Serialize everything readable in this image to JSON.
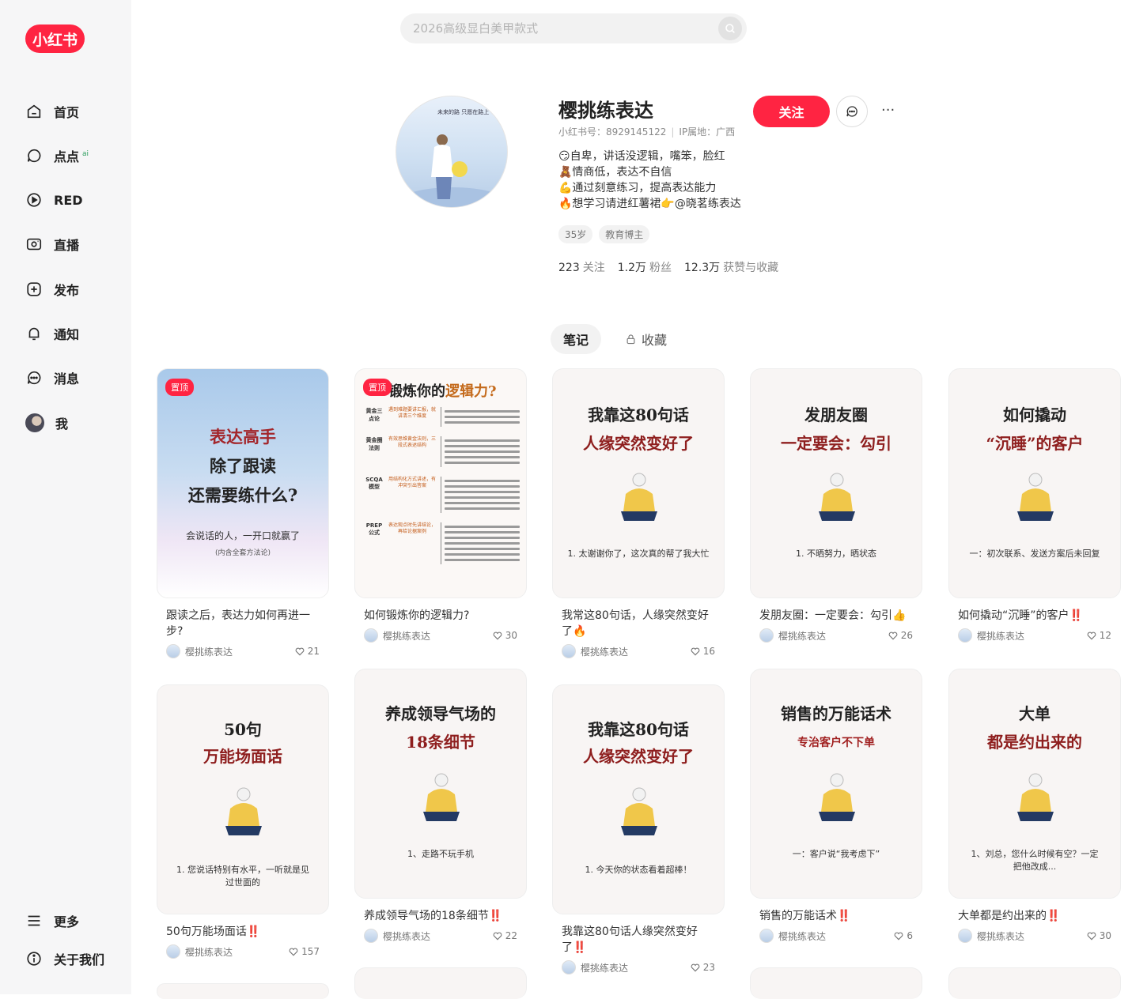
{
  "logo": "小红书",
  "nav": [
    {
      "label": "首页",
      "icon": "home-icon"
    },
    {
      "label": "点点",
      "icon": "chat-bubble-icon",
      "badge": "ai"
    },
    {
      "label": "RED",
      "icon": "play-icon"
    },
    {
      "label": "直播",
      "icon": "live-icon"
    },
    {
      "label": "发布",
      "icon": "plus-square-icon"
    },
    {
      "label": "通知",
      "icon": "bell-icon"
    },
    {
      "label": "消息",
      "icon": "message-icon"
    },
    {
      "label": "我",
      "icon": "avatar"
    }
  ],
  "nav_bottom": [
    {
      "label": "更多",
      "icon": "menu-icon"
    },
    {
      "label": "关于我们",
      "icon": "info-icon"
    }
  ],
  "search": {
    "placeholder": "2026高级显白美甲款式"
  },
  "profile": {
    "avatar_text": "未来的路 只愿在路上",
    "name": "樱挑练表达",
    "id_label": "小红书号：8929145122",
    "ip_label": "IP属地：广西",
    "bio": [
      "😏自卑，讲话没逻辑，嘴笨，脸红",
      "🧸情商低，表达不自信",
      "💪通过刻意练习，提高表达能力",
      "🔥想学习请进红薯裙👉@晓茗练表达"
    ],
    "tags": [
      "35岁",
      "教育博主"
    ],
    "stats": [
      {
        "value": "223",
        "label": "关注"
      },
      {
        "value": "1.2万",
        "label": "粉丝"
      },
      {
        "value": "12.3万",
        "label": "获赞与收藏"
      }
    ],
    "follow_label": "关注",
    "more_label": "···"
  },
  "tabs": [
    {
      "label": "笔记",
      "active": true
    },
    {
      "label": "收藏",
      "active": false,
      "icon": "lock-icon"
    }
  ],
  "pin_label": "置顶",
  "author": "樱挑练表达",
  "cards": [
    {
      "cover_t1": "表达高手",
      "cover_t2": "除了跟读",
      "cover_t3": "还需要练什么?",
      "cover_foot": "会说话的人，一开口就赢了",
      "cover_foot2": "(内含全套方法论)",
      "title": "跟读之后，表达力如何再进一步?",
      "likes": "21"
    },
    {
      "cover_t1": "锻炼你的",
      "cover_t2": "逻辑力?",
      "title": "如何锻炼你的逻辑力?",
      "likes": "30",
      "mind": [
        {
          "node": "黄金三点论",
          "mid": "遇到难题要讲汇报，就讲清三个维度"
        },
        {
          "node": "黄金圈法则",
          "mid": "有效思维黄金法则，三段式表述结构"
        },
        {
          "node": "SCQA模型",
          "mid": "用结构化方式讲述，有冲突引出答案"
        },
        {
          "node": "PREP公式",
          "mid": "表达观点时先讲结论，再给论据案例"
        }
      ]
    },
    {
      "cover_t1": "我靠这80句话",
      "cover_t2": "人缘突然变好了",
      "cover_foot": "1. 太谢谢你了，这次真的帮了我大忙",
      "title": "我常这80句话，人缘突然变好了🔥",
      "likes": "16"
    },
    {
      "cover_t1": "发朋友圈",
      "cover_t2": "一定要会：勾引",
      "cover_foot": "1. 不晒努力，晒状态",
      "title": "发朋友圈：一定要会：勾引👍",
      "likes": "26"
    },
    {
      "cover_t1": "如何撬动",
      "cover_t2": "“沉睡”的客户",
      "cover_foot": "一：初次联系、发送方案后未回复",
      "title": "如何撬动“沉睡”的客户‼️",
      "likes": "12"
    },
    {
      "cover_t1": "50句",
      "cover_t2": "万能场面话",
      "cover_foot": "1. 您说话特别有水平，一听就是见过世面的",
      "title": "50句万能场面话‼️",
      "likes": "157"
    },
    {
      "cover_t1": "养成领导气场的",
      "cover_t2": "18条细节",
      "cover_foot": "1、走路不玩手机",
      "title": "养成领导气场的18条细节‼️",
      "likes": "22"
    },
    {
      "cover_t1": "我靠这80句话",
      "cover_t2": "人缘突然变好了",
      "cover_foot": "1. 今天你的状态看着超棒！",
      "title": "我靠这80句话人缘突然变好了‼️",
      "likes": "23"
    },
    {
      "cover_t1": "销售的万能话术",
      "cover_t2": "专治客户不下单",
      "cover_foot": "一：客户说“我考虑下”",
      "title": "销售的万能话术‼️",
      "likes": "6"
    },
    {
      "cover_t1": "大单",
      "cover_t2": "都是约出来的",
      "cover_foot": "1、刘总，您什么时候有空？一定把他改成...",
      "title": "大单都是约出来的‼️",
      "likes": "30"
    }
  ]
}
